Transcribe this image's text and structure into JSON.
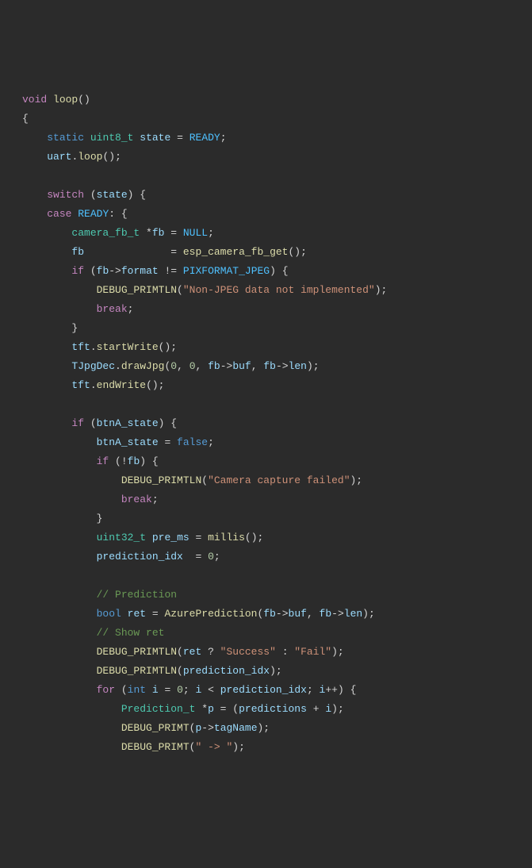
{
  "code": {
    "l1": {
      "kw1": "void",
      "fn": "loop",
      "p": "()"
    },
    "l2": {
      "brace": "{"
    },
    "l3": {
      "kw": "static",
      "type": "uint8_t",
      "var": "state",
      "op": "=",
      "val": "READY",
      "sc": ";"
    },
    "l4": {
      "obj": "uart",
      "dot": ".",
      "fn": "loop",
      "p": "();"
    },
    "l5": {
      "blank": ""
    },
    "l6": {
      "kw": "switch",
      "open": " (",
      "var": "state",
      "close": ") {"
    },
    "l7": {
      "kw": "case",
      "val": "READY",
      "close": ": {"
    },
    "l8": {
      "type": "camera_fb_t",
      "star": " *",
      "var": "fb",
      "eq": " = ",
      "null": "NULL",
      "sc": ";"
    },
    "l9": {
      "var": "fb",
      "pad": "              ",
      "eq": "= ",
      "fn": "esp_camera_fb_get",
      "p": "();"
    },
    "l10": {
      "kw": "if",
      "open": " (",
      "var": "fb",
      "arrow": "->",
      "fld": "format",
      "neq": " != ",
      "const": "PIXFORMAT_JPEG",
      "close": ") {"
    },
    "l11": {
      "fn": "DEBUG_PRIMTLN",
      "p1": "(",
      "str": "\"Non-JPEG data not implemented\"",
      "p2": ");"
    },
    "l12": {
      "kw": "break",
      "sc": ";"
    },
    "l13": {
      "brace": "}"
    },
    "l14": {
      "obj": "tft",
      "dot": ".",
      "fn": "startWrite",
      "p": "();"
    },
    "l15": {
      "obj": "TJpgDec",
      "dot": ".",
      "fn": "drawJpg",
      "p1": "(",
      "n1": "0",
      "c1": ", ",
      "n2": "0",
      "c2": ", ",
      "v1": "fb",
      "a1": "->",
      "f1": "buf",
      "c3": ", ",
      "v2": "fb",
      "a2": "->",
      "f2": "len",
      "p2": ");"
    },
    "l16": {
      "obj": "tft",
      "dot": ".",
      "fn": "endWrite",
      "p": "();"
    },
    "l17": {
      "blank": ""
    },
    "l18": {
      "kw": "if",
      "open": " (",
      "var": "btnA_state",
      "close": ") {"
    },
    "l19": {
      "var": "btnA_state",
      "eq": " = ",
      "val": "false",
      "sc": ";"
    },
    "l20": {
      "kw": "if",
      "open": " (!",
      "var": "fb",
      "close": ") {"
    },
    "l21": {
      "fn": "DEBUG_PRIMTLN",
      "p1": "(",
      "str": "\"Camera capture failed\"",
      "p2": ");"
    },
    "l22": {
      "kw": "break",
      "sc": ";"
    },
    "l23": {
      "brace": "}"
    },
    "l24": {
      "type": "uint32_t",
      "var": "pre_ms",
      "eq": " = ",
      "fn": "millis",
      "p": "();"
    },
    "l25": {
      "var": "prediction_idx",
      "pad": "  ",
      "eq": "= ",
      "n": "0",
      "sc": ";"
    },
    "l26": {
      "blank": ""
    },
    "l27": {
      "cmt": "// Prediction"
    },
    "l28": {
      "type": "bool",
      "var": "ret",
      "eq": " = ",
      "fn": "AzurePrediction",
      "p1": "(",
      "v1": "fb",
      "a1": "->",
      "f1": "buf",
      "c1": ", ",
      "v2": "fb",
      "a2": "->",
      "f2": "len",
      "p2": ");"
    },
    "l29": {
      "cmt": "// Show ret"
    },
    "l30": {
      "fn": "DEBUG_PRIMTLN",
      "p1": "(",
      "var": "ret",
      "q": " ? ",
      "s1": "\"Success\"",
      "col": " : ",
      "s2": "\"Fail\"",
      "p2": ");"
    },
    "l31": {
      "fn": "DEBUG_PRIMTLN",
      "p1": "(",
      "var": "prediction_idx",
      "p2": ");"
    },
    "l32": {
      "kw": "for",
      "open": " (",
      "type": "int",
      "var": "i",
      "eq": " = ",
      "n1": "0",
      "sc1": "; ",
      "v2": "i",
      "lt": " < ",
      "v3": "prediction_idx",
      "sc2": "; ",
      "v4": "i",
      "inc": "++",
      "close": ") {"
    },
    "l33": {
      "type": "Prediction_t",
      "star": " *",
      "var": "p",
      "eq": " = (",
      "v2": "predictions",
      "plus": " + ",
      "v3": "i",
      "close": ");"
    },
    "l34": {
      "fn": "DEBUG_PRIMT",
      "p1": "(",
      "var": "p",
      "arrow": "->",
      "fld": "tagName",
      "p2": ");"
    },
    "l35": {
      "fn": "DEBUG_PRIMT",
      "p1": "(",
      "str": "\" -> \"",
      "p2": ");"
    }
  }
}
